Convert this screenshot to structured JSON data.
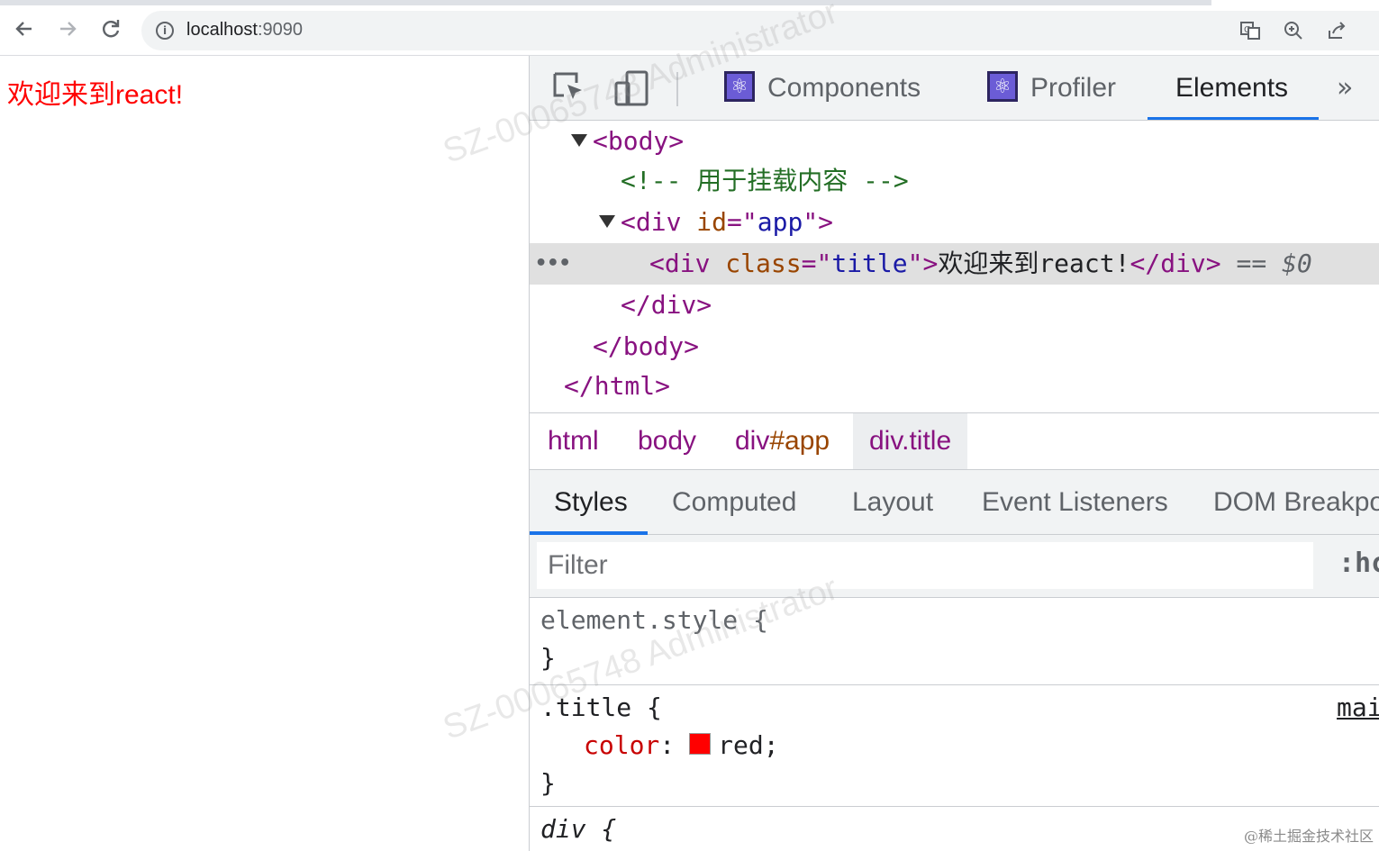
{
  "browser": {
    "url_host": "localhost",
    "url_port": ":9090",
    "back_icon": "arrow-left-icon",
    "forward_icon": "arrow-right-icon",
    "reload_icon": "reload-icon",
    "info_icon": "info-icon",
    "translate_icon": "translate-icon",
    "zoom_icon": "zoom-icon",
    "share_icon": "share-icon",
    "star_icon": "star-icon"
  },
  "page": {
    "title": "欢迎来到react!",
    "title_color": "#ff0000"
  },
  "devtools": {
    "tabs": [
      {
        "label": "Components"
      },
      {
        "label": "Profiler"
      },
      {
        "label": "Elements"
      }
    ],
    "more": "»",
    "dom": {
      "body_open": "<body>",
      "comment": "<!-- 用于挂载内容 -->",
      "div_app_tag": "<div ",
      "div_app_attr": "id",
      "div_app_eq": "=\"",
      "div_app_val": "app",
      "div_app_close": "\">",
      "sel_open": "<div ",
      "sel_attr": "class",
      "sel_eq": "=\"",
      "sel_val": "title",
      "sel_close": "\">",
      "sel_text": "欢迎来到react!",
      "sel_end": "</div>",
      "sel_marker": " == ",
      "sel_dollar": "$0",
      "dots": "•••",
      "div_close": "</div>",
      "body_close": "</body>",
      "html_close": "</html>"
    },
    "breadcrumbs": {
      "html": "html",
      "body": "body",
      "div_app_tag": "div",
      "div_app_id": "#app",
      "div_title": "div.title"
    },
    "style_tabs": [
      "Styles",
      "Computed",
      "Layout",
      "Event Listeners",
      "DOM Breakpo"
    ],
    "filter_placeholder": "Filter",
    "hov": ":hc",
    "rules": {
      "element_style": "element.style {",
      "element_close": "}",
      "title_selector": ".title {",
      "title_prop": "color",
      "title_colon": ":",
      "title_value": "red;",
      "title_close": "}",
      "title_source": "mai",
      "div_selector": "div {"
    }
  },
  "watermarks": [
    "SZ-00065748  Administrator",
    "SZ-00065748  Administrator"
  ],
  "credit": "@稀土掘金技术社区"
}
